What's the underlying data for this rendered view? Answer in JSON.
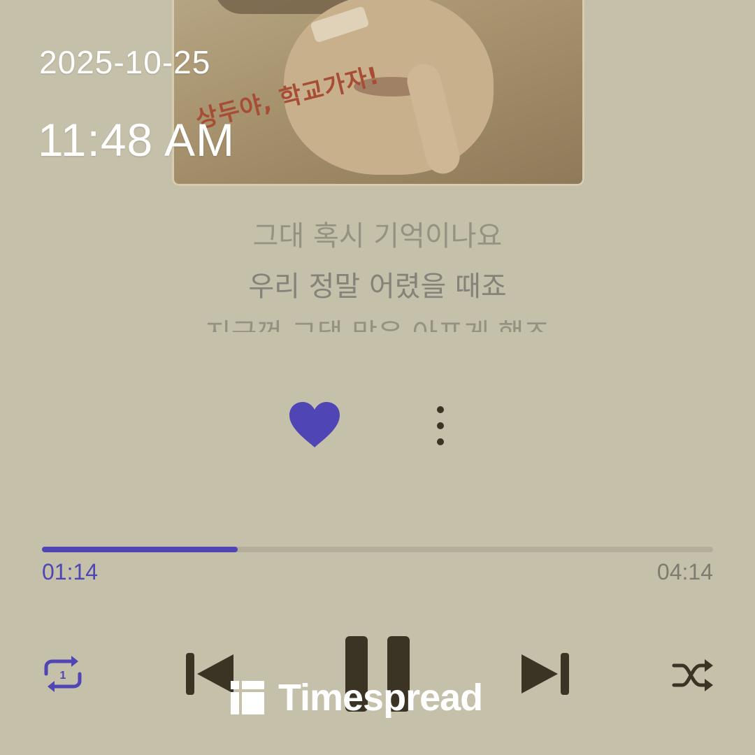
{
  "status": {
    "date": "2025-10-25",
    "time": "11:48 AM"
  },
  "album": {
    "overlay_text": "상두야, 학교가자!"
  },
  "lyrics": {
    "previous": "그대 혹시 기억이나요",
    "current": "우리 정말 어렸을 때죠",
    "next": "지금껏 그댈 많은 아프게 했죠"
  },
  "actions": {
    "like_icon": "heart-icon",
    "more_icon": "more-vertical-icon"
  },
  "playback": {
    "elapsed": "01:14",
    "total": "04:14",
    "progress": 0.2913,
    "accent_color": "#4f45b5",
    "control_color": "#3b3424"
  },
  "controls": {
    "repeat_icon": "repeat-one-icon",
    "previous_icon": "skip-previous-icon",
    "pause_icon": "pause-icon",
    "next_icon": "skip-next-icon",
    "shuffle_icon": "shuffle-icon"
  },
  "watermark": {
    "text": "Timespread"
  }
}
